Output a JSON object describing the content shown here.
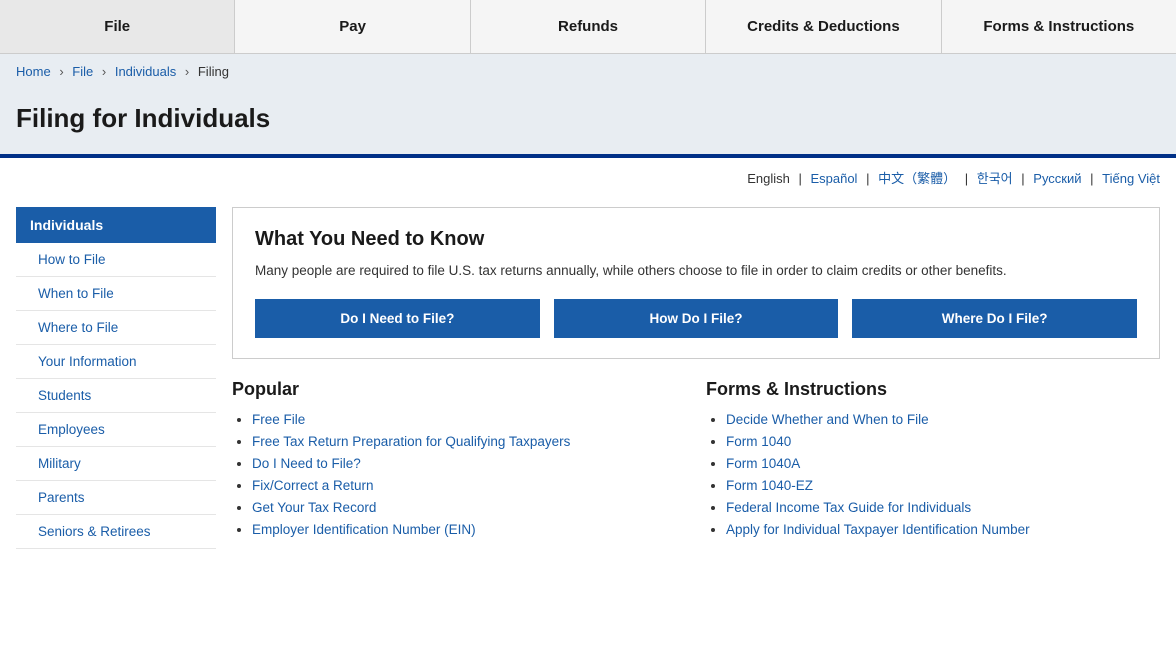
{
  "nav": {
    "items": [
      {
        "label": "File"
      },
      {
        "label": "Pay"
      },
      {
        "label": "Refunds"
      },
      {
        "label": "Credits & Deductions"
      },
      {
        "label": "Forms & Instructions"
      }
    ]
  },
  "breadcrumb": {
    "items": [
      {
        "label": "Home",
        "href": "#"
      },
      {
        "label": "File",
        "href": "#"
      },
      {
        "label": "Individuals",
        "href": "#"
      },
      {
        "label": "Filing",
        "href": "#"
      }
    ]
  },
  "pageTitle": "Filing for Individuals",
  "languages": {
    "current": "English",
    "links": [
      {
        "label": "Español"
      },
      {
        "label": "中文（繁體）"
      },
      {
        "label": "한국어"
      },
      {
        "label": "Русский"
      },
      {
        "label": "Tiếng Việt"
      }
    ]
  },
  "sidebar": {
    "header": "Individuals",
    "items": [
      {
        "label": "How to File"
      },
      {
        "label": "When to File"
      },
      {
        "label": "Where to File"
      },
      {
        "label": "Your Information"
      },
      {
        "label": "Students"
      },
      {
        "label": "Employees"
      },
      {
        "label": "Military"
      },
      {
        "label": "Parents"
      },
      {
        "label": "Seniors & Retirees"
      }
    ]
  },
  "infoBox": {
    "title": "What You Need to Know",
    "description": "Many people are required to file U.S. tax returns annually, while others choose to file in order to claim credits or other benefits.",
    "buttons": [
      {
        "label": "Do I Need to File?"
      },
      {
        "label": "How Do I File?"
      },
      {
        "label": "Where Do I File?"
      }
    ]
  },
  "popular": {
    "heading": "Popular",
    "links": [
      {
        "label": "Free File"
      },
      {
        "label": "Free Tax Return Preparation for Qualifying Taxpayers"
      },
      {
        "label": "Do I Need to File?"
      },
      {
        "label": "Fix/Correct a Return"
      },
      {
        "label": "Get Your Tax Record"
      },
      {
        "label": "Employer Identification Number (EIN)"
      }
    ]
  },
  "formsInstructions": {
    "heading": "Forms & Instructions",
    "links": [
      {
        "label": "Decide Whether and When to File"
      },
      {
        "label": "Form 1040"
      },
      {
        "label": "Form 1040A"
      },
      {
        "label": "Form 1040-EZ"
      },
      {
        "label": "Federal Income Tax Guide for Individuals"
      },
      {
        "label": "Apply for Individual Taxpayer Identification Number"
      }
    ]
  }
}
